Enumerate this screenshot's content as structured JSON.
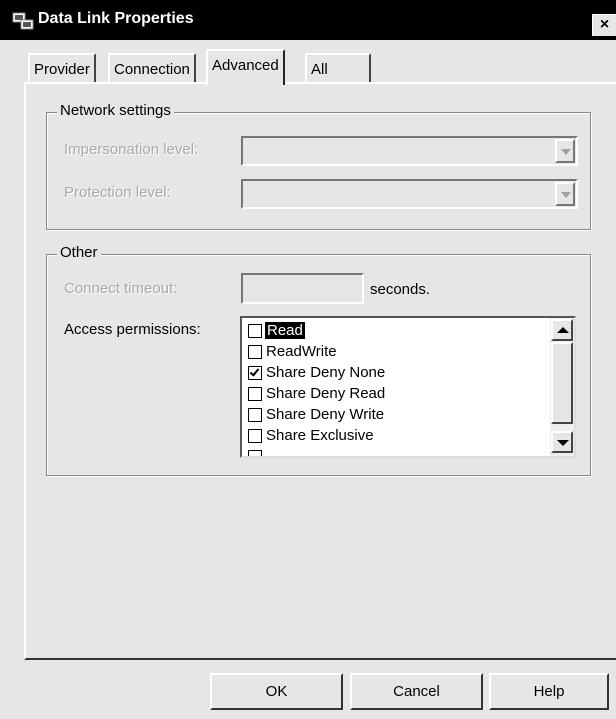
{
  "window": {
    "title": "Data Link Properties",
    "close_glyph": "×",
    "icon": "data-link-icon"
  },
  "tabs": [
    {
      "label": "Provider",
      "active": false
    },
    {
      "label": "Connection",
      "active": false
    },
    {
      "label": "Advanced",
      "active": true
    },
    {
      "label": "All",
      "active": false
    }
  ],
  "network_settings": {
    "title": "Network settings",
    "impersonation_label": "Impersonation level:",
    "impersonation_value": "",
    "protection_label": "Protection level:",
    "protection_value": ""
  },
  "other": {
    "title": "Other",
    "connect_timeout_label": "Connect timeout:",
    "connect_timeout_value": "",
    "seconds_label": "seconds.",
    "access_label": "Access permissions:",
    "permissions": [
      {
        "label": "Read",
        "checked": false,
        "selected": true
      },
      {
        "label": "ReadWrite",
        "checked": false,
        "selected": false
      },
      {
        "label": "Share Deny None",
        "checked": true,
        "selected": false
      },
      {
        "label": "Share Deny Read",
        "checked": false,
        "selected": false
      },
      {
        "label": "Share Deny Write",
        "checked": false,
        "selected": false
      },
      {
        "label": "Share Exclusive",
        "checked": false,
        "selected": false
      }
    ]
  },
  "buttons": {
    "ok": "OK",
    "cancel": "Cancel",
    "help": "Help"
  },
  "colors": {
    "face": "#e6e6e6",
    "titlebar": "#000000",
    "disabled_text": "#a9a9a9"
  }
}
